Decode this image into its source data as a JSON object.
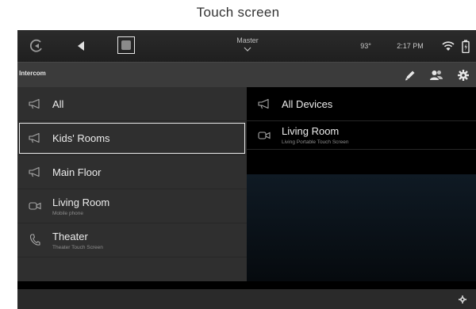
{
  "caption": "Touch screen",
  "status_bar": {
    "title": "Master",
    "temperature": "93°",
    "time": "2:17 PM",
    "icons": [
      "logo-icon",
      "back-arrow-icon",
      "camera-app-icon",
      "chevron-down-icon",
      "wifi-icon",
      "battery-icon"
    ]
  },
  "toolbar": {
    "title": "Intercom",
    "icons": [
      "edit-icon",
      "people-icon",
      "settings-gear-icon"
    ]
  },
  "left_list": [
    {
      "label": "All",
      "subtitle": "",
      "icon": "megaphone-icon",
      "selected": false
    },
    {
      "label": "Kids' Rooms",
      "subtitle": "",
      "icon": "megaphone-icon",
      "selected": true
    },
    {
      "label": "Main Floor",
      "subtitle": "",
      "icon": "megaphone-icon",
      "selected": false
    },
    {
      "label": "Living Room",
      "subtitle": "Mobile phone",
      "icon": "video-camera-icon",
      "selected": false
    },
    {
      "label": "Theater",
      "subtitle": "Theater Touch Screen",
      "icon": "phone-icon",
      "selected": false
    }
  ],
  "right_list": [
    {
      "label": "All Devices",
      "subtitle": "",
      "icon": "megaphone-icon"
    },
    {
      "label": "Living Room",
      "subtitle": "Living Portable Touch Screen",
      "icon": "video-camera-icon"
    }
  ],
  "bottom_bar": {
    "icon": "settings-small-icon"
  }
}
